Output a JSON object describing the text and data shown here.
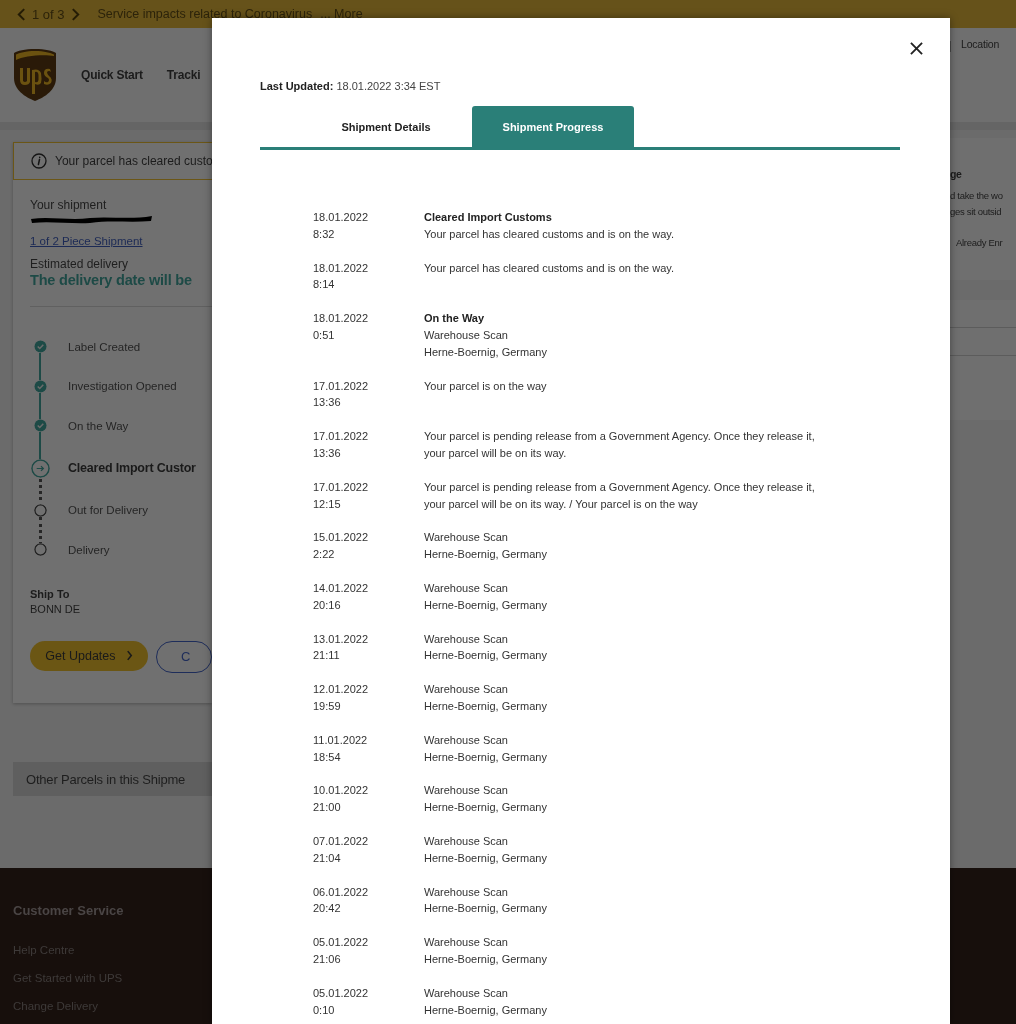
{
  "banner": {
    "counter": "1 of 3",
    "message": "Service impacts related to Coronavirus",
    "more_link": "... More"
  },
  "header": {
    "nav": [
      "Quick Start",
      "Tracki"
    ],
    "right_link": "Location"
  },
  "alert": {
    "text": "Your parcel has cleared custo"
  },
  "shipment": {
    "label": "Your shipment",
    "piece_link": "1 of 2 Piece Shipment",
    "estimated_label": "Estimated delivery",
    "estimated_value": "The delivery date will be"
  },
  "steps": [
    {
      "label": "Label Created",
      "kind": "done"
    },
    {
      "label": "Investigation Opened",
      "kind": "done"
    },
    {
      "label": "On the Way",
      "kind": "done"
    },
    {
      "label": "Cleared Import Custor",
      "kind": "current"
    },
    {
      "label": "Out for Delivery",
      "kind": "pending"
    },
    {
      "label": "Delivery",
      "kind": "pending"
    }
  ],
  "ship_to": {
    "label": "Ship To",
    "value": "BONN DE"
  },
  "buttons": {
    "primary": "Get Updates",
    "secondary": "C"
  },
  "other_parcels": "Other Parcels in this Shipme",
  "right_panel": {
    "title": "ge",
    "lines": [
      "d take the wo",
      "ges sit outsid"
    ],
    "link": "Already Enr"
  },
  "footer": {
    "title": "Customer Service",
    "links": [
      "Help Centre",
      "Get Started with UPS",
      "Change Delivery"
    ]
  },
  "modal": {
    "last_updated_label": "Last Updated:",
    "last_updated_value": "18.01.2022 3:34 EST",
    "tabs": [
      {
        "label": "Shipment Details",
        "selected": false
      },
      {
        "label": "Shipment Progress",
        "selected": true
      }
    ],
    "events": [
      {
        "date": "18.01.2022",
        "time": "8:32",
        "title": "Cleared Import Customs",
        "lines": [
          "Your parcel has cleared customs and is on the way."
        ]
      },
      {
        "date": "18.01.2022",
        "time": "8:14",
        "lines": [
          "Your parcel has cleared customs and is on the way."
        ]
      },
      {
        "date": "18.01.2022",
        "time": "0:51",
        "title": "On the Way",
        "lines": [
          "Warehouse Scan",
          "Herne-Boernig, Germany"
        ]
      },
      {
        "date": "17.01.2022",
        "time": "13:36",
        "lines": [
          "Your parcel is on the way"
        ]
      },
      {
        "date": "17.01.2022",
        "time": "13:36",
        "lines": [
          "Your parcel is pending release from a Government Agency. Once they release it, your parcel will be on its way."
        ]
      },
      {
        "date": "17.01.2022",
        "time": "12:15",
        "lines": [
          "Your parcel is pending release from a Government Agency. Once they release it, your parcel will be on its way. / Your parcel is on the way"
        ]
      },
      {
        "date": "15.01.2022",
        "time": "2:22",
        "lines": [
          "Warehouse Scan",
          "Herne-Boernig, Germany"
        ]
      },
      {
        "date": "14.01.2022",
        "time": "20:16",
        "lines": [
          "Warehouse Scan",
          "Herne-Boernig, Germany"
        ]
      },
      {
        "date": "13.01.2022",
        "time": "21:11",
        "lines": [
          "Warehouse Scan",
          "Herne-Boernig, Germany"
        ]
      },
      {
        "date": "12.01.2022",
        "time": "19:59",
        "lines": [
          "Warehouse Scan",
          "Herne-Boernig, Germany"
        ]
      },
      {
        "date": "11.01.2022",
        "time": "18:54",
        "lines": [
          "Warehouse Scan",
          "Herne-Boernig, Germany"
        ]
      },
      {
        "date": "10.01.2022",
        "time": "21:00",
        "lines": [
          "Warehouse Scan",
          "Herne-Boernig, Germany"
        ]
      },
      {
        "date": "07.01.2022",
        "time": "21:04",
        "lines": [
          "Warehouse Scan",
          "Herne-Boernig, Germany"
        ]
      },
      {
        "date": "06.01.2022",
        "time": "20:42",
        "lines": [
          "Warehouse Scan",
          "Herne-Boernig, Germany"
        ]
      },
      {
        "date": "05.01.2022",
        "time": "21:06",
        "lines": [
          "Warehouse Scan",
          "Herne-Boernig, Germany"
        ]
      },
      {
        "date": "05.01.2022",
        "time": "0:10",
        "lines": [
          "Warehouse Scan",
          "Herne-Boernig, Germany"
        ]
      }
    ]
  }
}
